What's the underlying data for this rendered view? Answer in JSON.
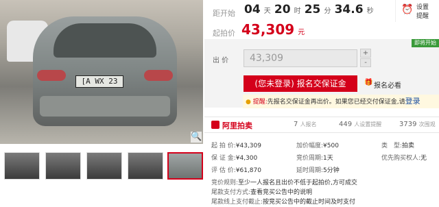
{
  "countdown": {
    "label": "距开始",
    "days": "04",
    "days_unit": "天",
    "hours": "20",
    "hours_unit": "时",
    "minutes": "25",
    "minutes_unit": "分",
    "seconds": "34.6",
    "seconds_unit": "秒"
  },
  "reminder": {
    "label": "设置\n提醒",
    "line1": "设置",
    "line2": "提醒"
  },
  "start_price": {
    "label": "起拍价",
    "value": "43,309",
    "unit": "元"
  },
  "bid": {
    "label": "出 价",
    "input_value": "43,309",
    "plus": "+",
    "minus": "-",
    "button_label": "(您未登录) 报名交保证金",
    "must_read": "报名必看",
    "status_tag": "即将开始"
  },
  "notice": {
    "prefix": "提醒:",
    "text": "先报名交保证金再出价。如果您已经交付保证金,请",
    "link": "登录"
  },
  "platform": {
    "name": "阿里拍卖"
  },
  "stats": {
    "signup_count": "7",
    "signup_label": "人报名",
    "reminder_count": "449",
    "reminder_label": "人设置提醒",
    "view_count": "3739",
    "view_label": "次围观"
  },
  "details": {
    "start_price_k": "起 拍 价:",
    "start_price_v": "¥43,309",
    "increment_k": "加价幅度:",
    "increment_v": "¥500",
    "type_k": "类　型:",
    "type_v": "拍卖",
    "deposit_k": "保 证 金:",
    "deposit_v": "¥4,300",
    "bid_cycle_k": "竞价周期:",
    "bid_cycle_v": "1天",
    "priority_k": "优先购买权人:",
    "priority_v": "无",
    "appraisal_k": "评 估 价:",
    "appraisal_v": "¥61,870",
    "delay_k": "延时周期:",
    "delay_v": "5分钟"
  },
  "rules": {
    "rule1_k": "竞价规则:",
    "rule1_v": "至少一人报名且出价不低于起拍价,方可成交",
    "rule2_k": "尾款支付方式:",
    "rule2_v": "查看竞买公告中的说明",
    "rule3_k": "尾款线上支付截止:",
    "rule3_v": "按竞买公告中的截止时间及时支付"
  },
  "photo": {
    "plate_text": "[A WX 23"
  },
  "colors": {
    "accent": "#d4001a",
    "status_green": "#3a9a3a"
  },
  "icons": [
    "alarm-clock-icon",
    "zoom-icon",
    "gift-icon",
    "lightbulb-icon",
    "ali-auction-logo"
  ]
}
